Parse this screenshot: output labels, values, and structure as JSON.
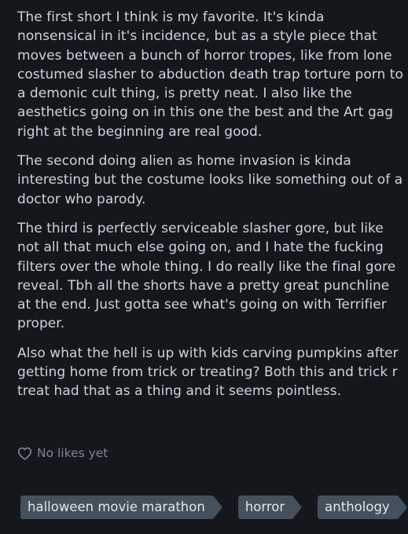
{
  "review": {
    "paragraphs": [
      "The first short I think is my favorite. It's kinda nonsensical in it's incidence, but as a style piece that moves between a bunch of horror tropes, like from lone costumed slasher to abduction death trap torture porn to a demonic cult thing, is pretty neat. I also like the aesthetics going on in this one the best and the Art gag right at the beginning are real good.",
      "The second doing alien as home invasion is kinda interesting but the costume looks like something out of a doctor who parody.",
      "The third is perfectly serviceable slasher gore, but like not all that much else going on, and I hate the fucking filters over the whole thing. I do really like the final gore reveal. Tbh all the shorts have a pretty great punchline at the end. Just gotta see what's going on with Terrifier proper.",
      "Also what the hell is up with kids carving pumpkins after getting home from trick or treating? Both this and trick r treat had that as a thing and it seems pointless."
    ]
  },
  "likes": {
    "icon": "heart-outline-icon",
    "label": "No likes yet"
  },
  "tags": [
    {
      "label": "halloween movie marathon"
    },
    {
      "label": "horror"
    },
    {
      "label": "anthology"
    }
  ],
  "colors": {
    "background": "#14181c",
    "text": "#ccd4dc",
    "muted": "#7b8693",
    "tag_bg": "#44505c"
  }
}
